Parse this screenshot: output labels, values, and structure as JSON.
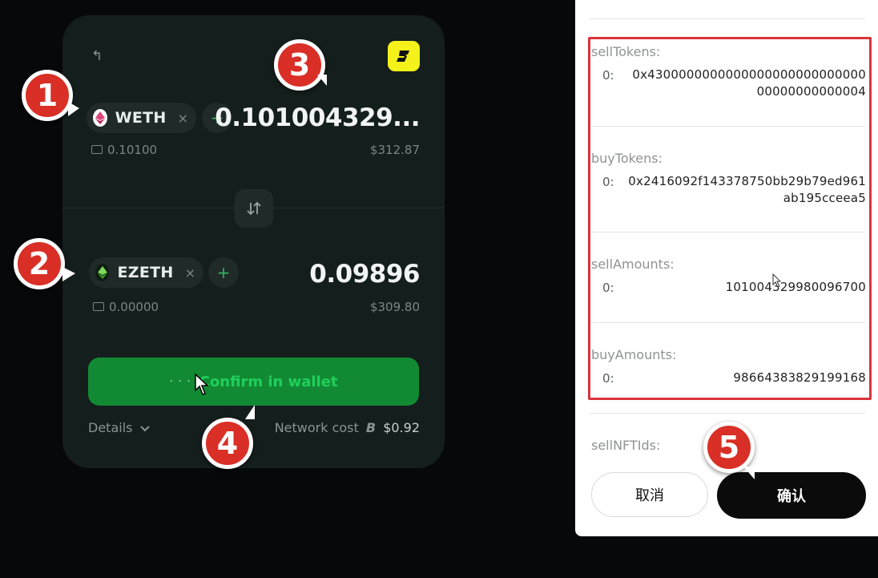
{
  "swap": {
    "sell": {
      "token": "WETH",
      "remove": "×",
      "add": "+",
      "amount": "0.101004329...",
      "balance": "0.10100",
      "usd": "$312.87"
    },
    "buy": {
      "token": "EZETH",
      "remove": "×",
      "add": "+",
      "amount": "0.09896",
      "balance": "0.00000",
      "usd": "$309.80"
    },
    "confirm_label": "Confirm in wallet",
    "confirm_dots": "· · ·",
    "details_label": "Details",
    "network_cost_label": "Network cost",
    "network_cost_value": "$0.92"
  },
  "markers": [
    "1",
    "2",
    "3",
    "4",
    "5"
  ],
  "panel": {
    "fields": [
      {
        "label": "sellTokens:",
        "index": "0:",
        "value": "0x430000000000000000000000000000000000000004"
      },
      {
        "label": "buyTokens:",
        "index": "0:",
        "value": "0x2416092f143378750bb29b79ed961ab195cceea5"
      },
      {
        "label": "sellAmounts:",
        "index": "0:",
        "value": "101004329980096700"
      },
      {
        "label": "buyAmounts:",
        "index": "0:",
        "value": "98664383829199168"
      }
    ],
    "next_field_label": "sellNFTIds:",
    "cancel_label": "取消",
    "confirm_label": "确认"
  },
  "colors": {
    "card_bg": "#141e1d",
    "confirm_green": "#128a34",
    "brand_yellow": "#f4f21a",
    "marker_red": "#d92f26",
    "highlight_red": "#d9343b"
  },
  "icons": [
    "back-arrow-icon",
    "brand-logo-icon",
    "weth-icon",
    "ezeth-icon",
    "swap-arrows-icon",
    "wallet-icon",
    "chevron-down-icon",
    "mouse-cursor-icon"
  ]
}
